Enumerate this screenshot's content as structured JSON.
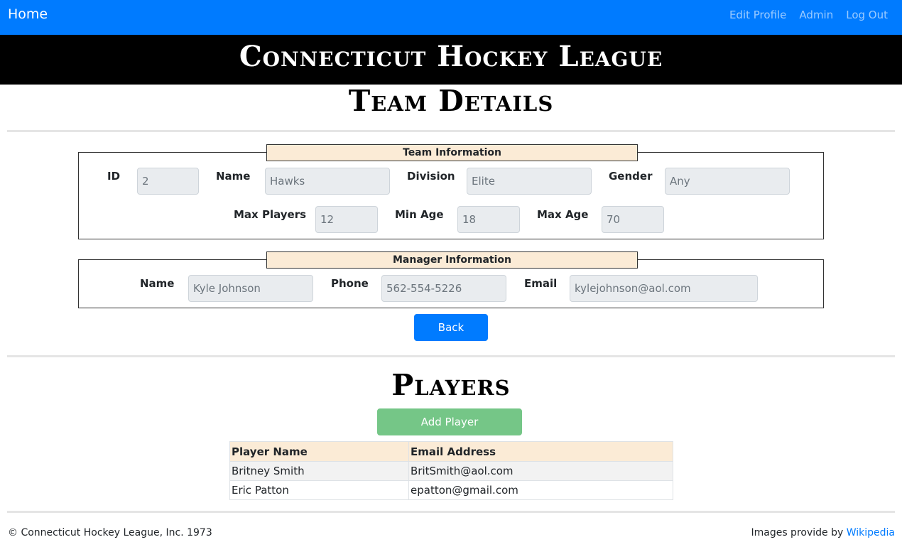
{
  "nav": {
    "home": "Home",
    "links": [
      "Edit Profile",
      "Admin",
      "Log Out"
    ]
  },
  "banner": {
    "title": "Connecticut Hockey League"
  },
  "page_title": "Team Details",
  "team_info": {
    "legend": "Team Information",
    "id_label": "ID",
    "id_value": "2",
    "name_label": "Name",
    "name_value": "Hawks",
    "division_label": "Division",
    "division_value": "Elite",
    "gender_label": "Gender",
    "gender_value": "Any",
    "max_players_label": "Max Players",
    "max_players_value": "12",
    "min_age_label": "Min Age",
    "min_age_value": "18",
    "max_age_label": "Max Age",
    "max_age_value": "70"
  },
  "manager_info": {
    "legend": "Manager Information",
    "name_label": "Name",
    "name_value": "Kyle Johnson",
    "phone_label": "Phone",
    "phone_value": "562-554-5226",
    "email_label": "Email",
    "email_value": "kylejohnson@aol.com"
  },
  "back_button": "Back",
  "players": {
    "title": "Players",
    "add_button": "Add Player",
    "columns": [
      "Player Name",
      "Email Address"
    ],
    "rows": [
      [
        "Britney Smith",
        "BritSmith@aol.com"
      ],
      [
        "Eric Patton",
        "epatton@gmail.com"
      ]
    ]
  },
  "footer": {
    "copyright": "© Connecticut Hockey League, Inc. 1973",
    "credit_prefix": "Images provide by",
    "credit_link": "Wikipedia"
  },
  "colors": {
    "navbar": "#007bff",
    "banner": "#000000",
    "legend_bg": "#fbebd6",
    "add_button": "#75c687",
    "link": "#007bff"
  }
}
